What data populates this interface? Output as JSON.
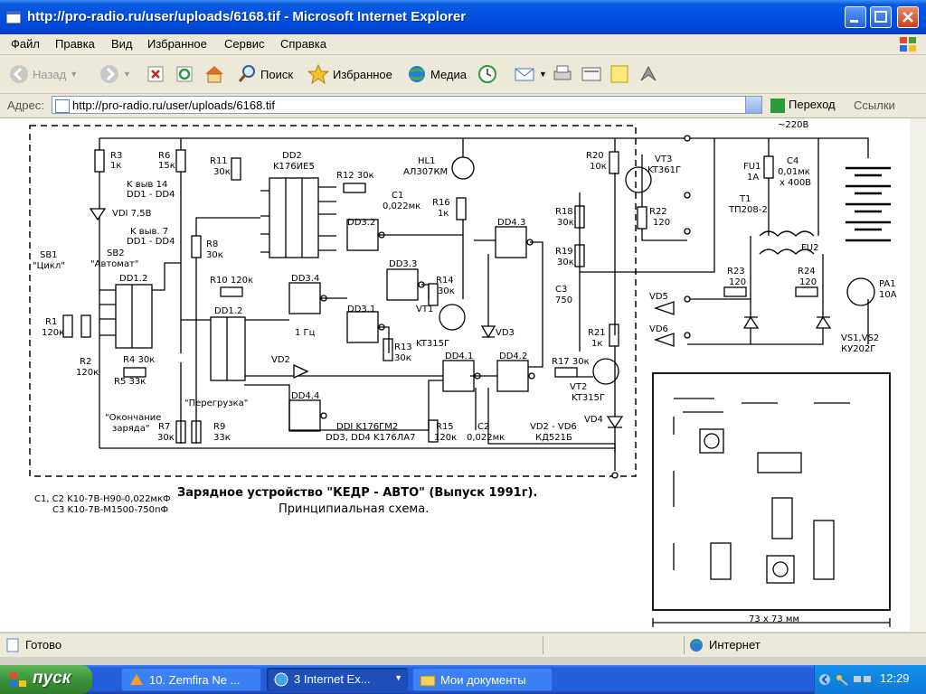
{
  "window": {
    "title": "http://pro-radio.ru/user/uploads/6168.tif - Microsoft Internet Explorer"
  },
  "menu": [
    "Файл",
    "Правка",
    "Вид",
    "Избранное",
    "Сервис",
    "Справка"
  ],
  "toolbar": {
    "back": "Назад",
    "search": "Поиск",
    "favorites": "Избранное",
    "media": "Медиа"
  },
  "address": {
    "label": "Адрес:",
    "url": "http://pro-radio.ru/user/uploads/6168.tif",
    "go": "Переход",
    "links": "Ссылки"
  },
  "status": {
    "left": "Готово",
    "zone": "Интернет"
  },
  "taskbar": {
    "start": "пуск",
    "tasks": [
      "10. Zemfira Ne ...",
      "3 Internet Ex...",
      "Мои документы"
    ],
    "clock": "12:29"
  },
  "schematic": {
    "title": "Зарядное устройство \"КЕДР - АВТО\" (Выпуск 1991г).",
    "subtitle": "Принципиальная схема.",
    "notes": [
      "C1, C2 K10-7B-H90-0,022мкФ",
      "C3 K10-7B-M1500-750пФ"
    ],
    "ic_notes": [
      "DDI K176ГM2",
      "DD3, DD4 K176ЛA7"
    ],
    "diode_note": "VD2 - VD6",
    "diode_note2": "КД521Б",
    "board_size": "73 x 73 мм",
    "labels": {
      "r3": "R3",
      "r3v": "1к",
      "r6": "R6",
      "r6v": "15к",
      "r11": "R11",
      "r11v": "30к",
      "dd2": "DD2",
      "dd2t": "K176ИЕ5",
      "r12": "R12 30к",
      "c1": "C1",
      "c1v": "0,022мк",
      "hl1": "HL1",
      "hl1v": "АЛ307КМ",
      "r16": "R16",
      "r16v": "1к",
      "r20": "R20",
      "r20v": "10к",
      "vt3": "VT3",
      "vt3v": "KT361Г",
      "r18": "R18",
      "r18v": "30к",
      "r19": "R19",
      "r19v": "30к",
      "r22": "R22",
      "r22v": "120",
      "c3": "C3",
      "c3v": "750",
      "r21": "R21",
      "r21v": "1к",
      "fu1": "FU1",
      "fu1v": "1A",
      "c4": "C4",
      "c4v": "0,01мк",
      "c4v2": "x 400B",
      "t1": "T1",
      "t1v": "TП208-2",
      "fu2": "FU2",
      "v220": "~220B",
      "r23": "R23",
      "r23v": "120",
      "r24": "R24",
      "r24v": "120",
      "pa1": "PA1",
      "pa1v": "10A",
      "vs": "VS1,VS2",
      "vsv": "КУ202Г",
      "vd5": "VD5",
      "vd6": "VD6",
      "vd4": "VD4",
      "kvyv14": "K выв 14",
      "dd1dd4a": "DD1 - DD4",
      "vd1": "VDI 7,5B",
      "kvyv7": "K выв. 7",
      "dd1dd4b": "DD1 - DD4",
      "sb2": "SB2",
      "sb2v": "\"Автомат\"",
      "sb1": "SB1",
      "sb1v": "\"Цикл\"",
      "dd12a": "DD1.2",
      "r1": "R1",
      "r1v": "120к",
      "r2": "R2",
      "r2v": "120к",
      "r4": "R4 30к",
      "r5": "R5 33к",
      "charge_end": "\"Окончание",
      "charge_end2": "заряда\"",
      "r7": "R7",
      "r7v": "30к",
      "r9": "R9",
      "r9v": "33к",
      "overload": "\"Перегрузка\"",
      "r8": "R8",
      "r8v": "30к",
      "r10": "R10 120к",
      "dd34": "DD3.4",
      "dd33": "DD3.3",
      "dd32": "DD3.2",
      "dd31": "DD3.1",
      "dd43": "DD4.3",
      "dd41": "DD4.1",
      "dd42": "DD4.2",
      "dd44": "DD4.4",
      "dd12b": "DD1.2",
      "r14": "R14",
      "r14v": "30к",
      "vt1": "VT1",
      "vt1v": "KT315Г",
      "vd3": "VD3",
      "r13": "R13",
      "r13v": "30к",
      "vd2": "VD2",
      "r17": "R17 30к",
      "vt2": "VT2",
      "vt2v": "KT315Г",
      "r15": "R15",
      "r15v": "120к",
      "c2": "C2",
      "c2v": "0,022мк",
      "hz": "1 Гц"
    }
  },
  "colors": {
    "titlebar": "#0050e0",
    "taskbar": "#245edb",
    "start": "#3c933a"
  }
}
